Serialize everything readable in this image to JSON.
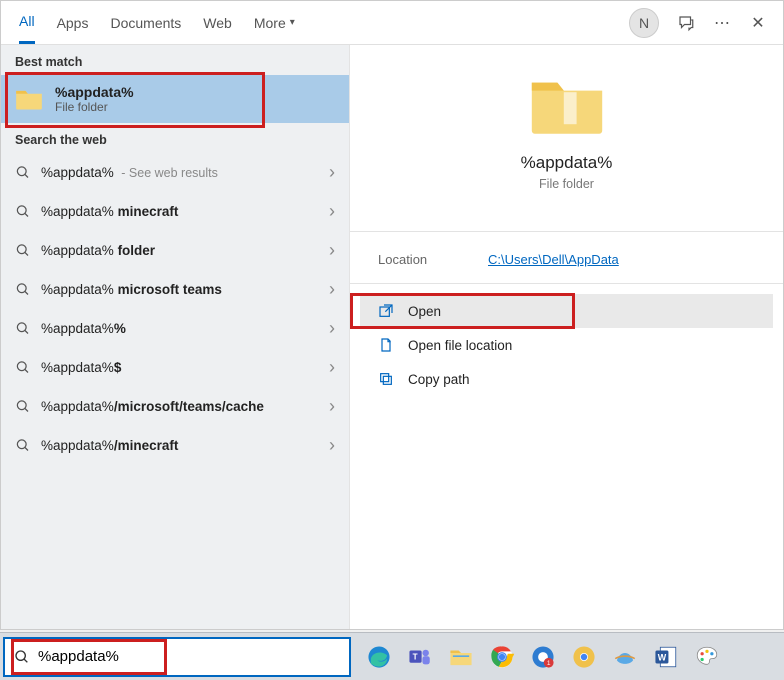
{
  "header": {
    "tabs": [
      "All",
      "Apps",
      "Documents",
      "Web",
      "More"
    ],
    "active_tab": 0,
    "avatar_initial": "N"
  },
  "left": {
    "best_match_label": "Best match",
    "best_match": {
      "title": "%appdata%",
      "subtitle": "File folder"
    },
    "search_web_label": "Search the web",
    "suggestions": [
      {
        "prefix": "%appdata%",
        "suffix": "",
        "hint": " - See web results"
      },
      {
        "prefix": "%appdata%",
        "suffix": " minecraft",
        "hint": ""
      },
      {
        "prefix": "%appdata%",
        "suffix": " folder",
        "hint": ""
      },
      {
        "prefix": "%appdata%",
        "suffix": " microsoft teams",
        "hint": ""
      },
      {
        "prefix": "%appdata%",
        "suffix": "%",
        "hint": ""
      },
      {
        "prefix": "%appdata%",
        "suffix": "$",
        "hint": ""
      },
      {
        "prefix": "%appdata%",
        "suffix": "/microsoft/teams/cache",
        "hint": ""
      },
      {
        "prefix": "%appdata%",
        "suffix": "/minecraft",
        "hint": ""
      }
    ]
  },
  "right": {
    "title": "%appdata%",
    "subtitle": "File folder",
    "location_label": "Location",
    "location_value": "C:\\Users\\Dell\\AppData",
    "actions": [
      {
        "icon": "open",
        "label": "Open",
        "highlight": true
      },
      {
        "icon": "filelocation",
        "label": "Open file location",
        "highlight": false
      },
      {
        "icon": "copy",
        "label": "Copy path",
        "highlight": false
      }
    ]
  },
  "search": {
    "value": "%appdata%"
  }
}
